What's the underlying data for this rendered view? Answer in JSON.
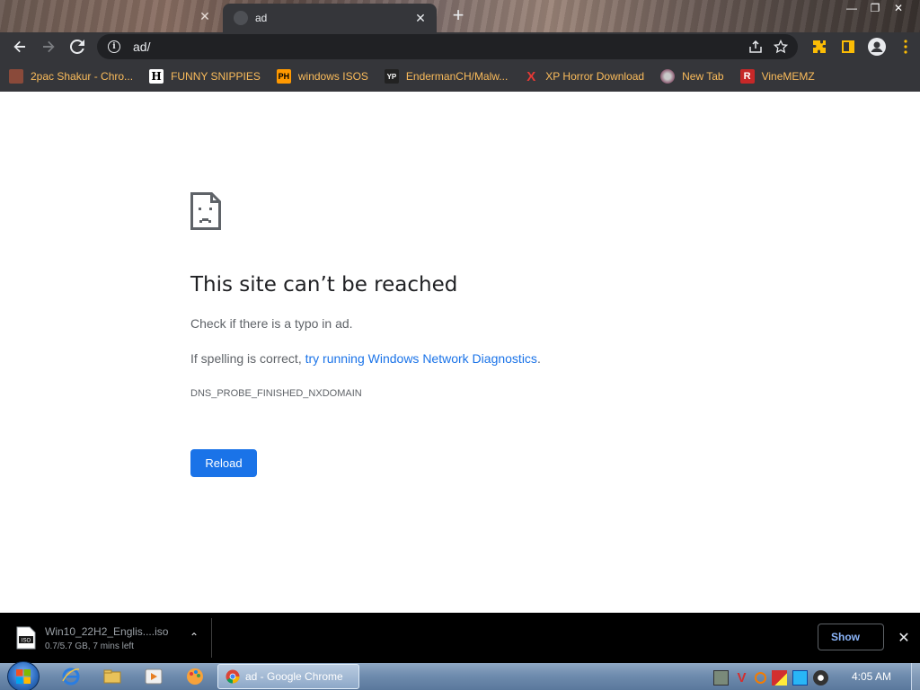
{
  "browser": {
    "tabs": [
      {
        "title": "",
        "active": false
      },
      {
        "title": "ad",
        "active": true
      }
    ],
    "address": "ad/",
    "bookmarks": [
      {
        "label": "2pac Shakur - Chro...",
        "icon": "2pac-icon"
      },
      {
        "label": "FUNNY SNIPPIES",
        "icon": "h-icon"
      },
      {
        "label": "windows ISOS",
        "icon": "ph-icon"
      },
      {
        "label": "EndermanCH/Malw...",
        "icon": "yp-icon"
      },
      {
        "label": "XP Horror Download",
        "icon": "x-icon"
      },
      {
        "label": "New Tab",
        "icon": "newtab-icon"
      },
      {
        "label": "VineMEMZ",
        "icon": "r-icon"
      }
    ],
    "bookmark_icon_text": {
      "h": "H",
      "ph": "PH",
      "yp": "YP",
      "x": "X",
      "r": "R"
    }
  },
  "error": {
    "title": "This site can’t be reached",
    "line1": "Check if there is a typo in ad.",
    "line2_prefix": "If spelling is correct, ",
    "line2_link": "try running Windows Network Diagnostics",
    "line2_suffix": ".",
    "code": "DNS_PROBE_FINISHED_NXDOMAIN",
    "reload_label": "Reload"
  },
  "download": {
    "file_name": "Win10_22H2_Englis....iso",
    "status": "0.7/5.7 GB, 7 mins left",
    "icon_text": "ISO",
    "show_all_label": "Show"
  },
  "taskbar": {
    "chrome_label": "ad - Google Chrome",
    "clock": "4:05 AM"
  },
  "colors": {
    "accent": "#1a73e8",
    "bookmark_text": "#fbbc5b",
    "toolbar": "#35363a"
  }
}
